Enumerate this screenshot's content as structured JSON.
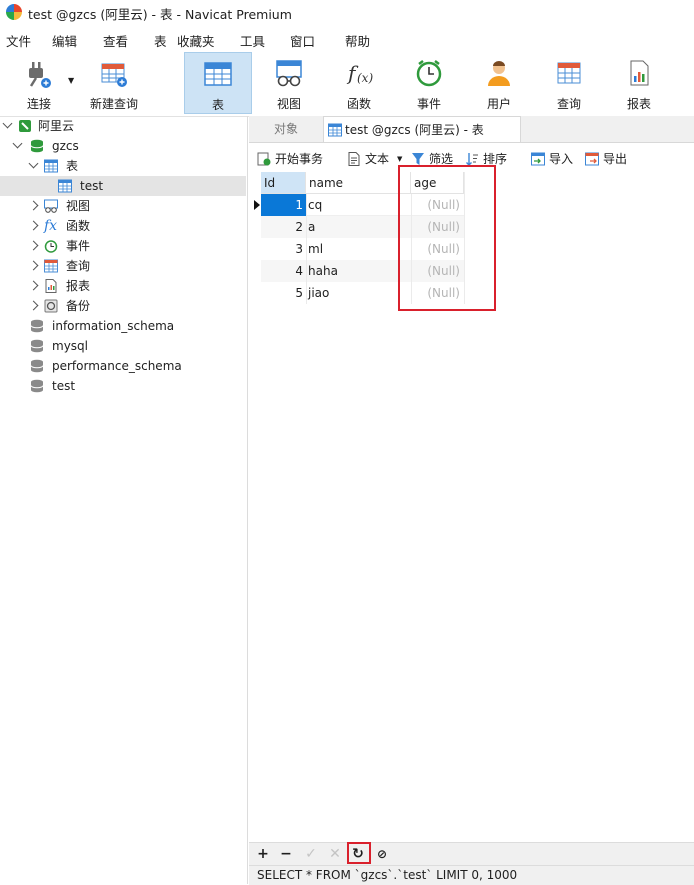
{
  "window": {
    "title": "test @gzcs (阿里云) - 表 - Navicat Premium"
  },
  "menu": [
    "文件",
    "编辑",
    "查看",
    "表",
    "收藏夹",
    "工具",
    "窗口",
    "帮助"
  ],
  "toolbar": {
    "connect": "连接",
    "new_query": "新建查询",
    "table": "表",
    "view": "视图",
    "function": "函数",
    "event": "事件",
    "user": "用户",
    "query": "查询",
    "report": "报表"
  },
  "tree": {
    "connection": "阿里云",
    "database": "gzcs",
    "tables_node": "表",
    "table_test": "test",
    "views": "视图",
    "functions": "函数",
    "events": "事件",
    "queries": "查询",
    "reports": "报表",
    "backups": "备份",
    "other_dbs": [
      "information_schema",
      "mysql",
      "performance_schema",
      "test"
    ]
  },
  "tabs": {
    "objects": "对象",
    "active": "test @gzcs (阿里云) - 表"
  },
  "subtoolbar": {
    "begin_txn": "开始事务",
    "text": "文本",
    "filter": "筛选",
    "sort": "排序",
    "import": "导入",
    "export": "导出"
  },
  "grid": {
    "columns": [
      "Id",
      "name",
      "age"
    ],
    "rows": [
      {
        "id": "1",
        "name": "cq",
        "age": "(Null)"
      },
      {
        "id": "2",
        "name": "a",
        "age": "(Null)"
      },
      {
        "id": "3",
        "name": "ml",
        "age": "(Null)"
      },
      {
        "id": "4",
        "name": "haha",
        "age": "(Null)"
      },
      {
        "id": "5",
        "name": "jiao",
        "age": "(Null)"
      }
    ]
  },
  "status": {
    "sql": "SELECT * FROM `gzcs`.`test` LIMIT 0, 1000"
  },
  "colors": {
    "accent": "#cde3f5",
    "highlight": "#d9202c",
    "selected_cell": "#0a78d7"
  }
}
